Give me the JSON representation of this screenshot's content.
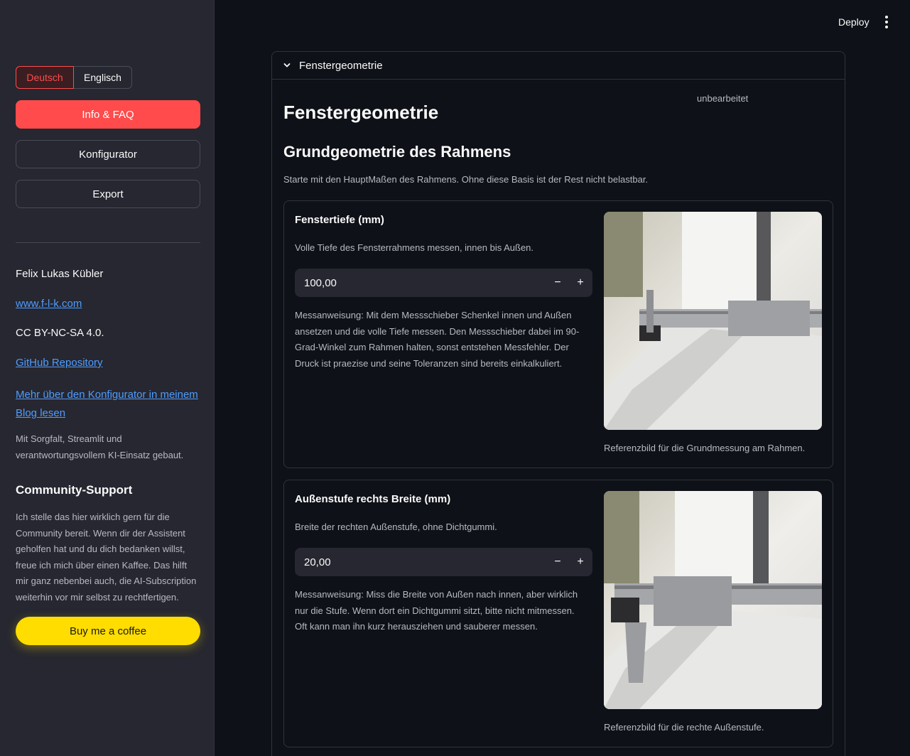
{
  "sidebar": {
    "lang_de": "Deutsch",
    "lang_en": "Englisch",
    "btn_info": "Info & FAQ",
    "btn_config": "Konfigurator",
    "btn_export": "Export",
    "author": "Felix Lukas Kübler",
    "website": "www.f-l-k.com",
    "license": "CC BY-NC-SA 4.0.",
    "github": "GitHub Repository",
    "blog_line1": "Mehr über den Konfigurator in meinem",
    "blog_line2": "Blog lesen",
    "made_with_line1": "Mit Sorgfalt, Streamlit und",
    "made_with_line2": "verantwortungsvollem KI-Einsatz gebaut.",
    "community_title": "Community-Support",
    "community_lines": [
      "Ich stelle das hier wirklich gern für die",
      "Community bereit. Wenn dir der Assistent",
      "geholfen hat und du dich bedanken willst,",
      "freue ich mich über einen Kaffee. Das hilft",
      "mir ganz nebenbei auch, die AI-Subscription",
      "weiterhin vor mir selbst zu rechtfertigen."
    ],
    "coffee": "Buy me a coffee"
  },
  "topbar": {
    "deploy": "Deploy"
  },
  "main": {
    "expander_label": "Fenstergeometrie",
    "status": "unbearbeitet",
    "title": "Fenstergeometrie",
    "section_title": "Grundgeometrie des Rahmens",
    "intro": "Starte mit den HauptMaßen des Rahmens. Ohne diese Basis ist der Rest nicht belastbar.",
    "cards": [
      {
        "title": "Fenstertiefe (mm)",
        "desc": "Volle Tiefe des Fensterrahmens messen, innen bis Außen.",
        "value": "100,00",
        "instr_lines": [
          "Messanweisung: Mit dem Messschieber Schenkel innen und Außen",
          "ansetzen und die volle Tiefe messen. Den Messschieber dabei im 90-",
          "Grad-Winkel zum Rahmen halten, sonst entstehen Messfehler. Der",
          "Druck ist praezise und seine Toleranzen sind bereits einkalkuliert."
        ],
        "caption": "Referenzbild für die Grundmessung am Rahmen."
      },
      {
        "title": "Außenstufe rechts Breite (mm)",
        "desc": "Breite der rechten Außenstufe, ohne Dichtgummi.",
        "value": "20,00",
        "instr_lines": [
          "Messanweisung: Miss die Breite von Außen nach innen, aber wirklich",
          "nur die Stufe. Wenn dort ein Dichtgummi sitzt, bitte nicht mitmessen.",
          "Oft kann man ihn kurz herausziehen und sauberer messen."
        ],
        "caption": "Referenzbild für die rechte Außenstufe."
      }
    ]
  }
}
